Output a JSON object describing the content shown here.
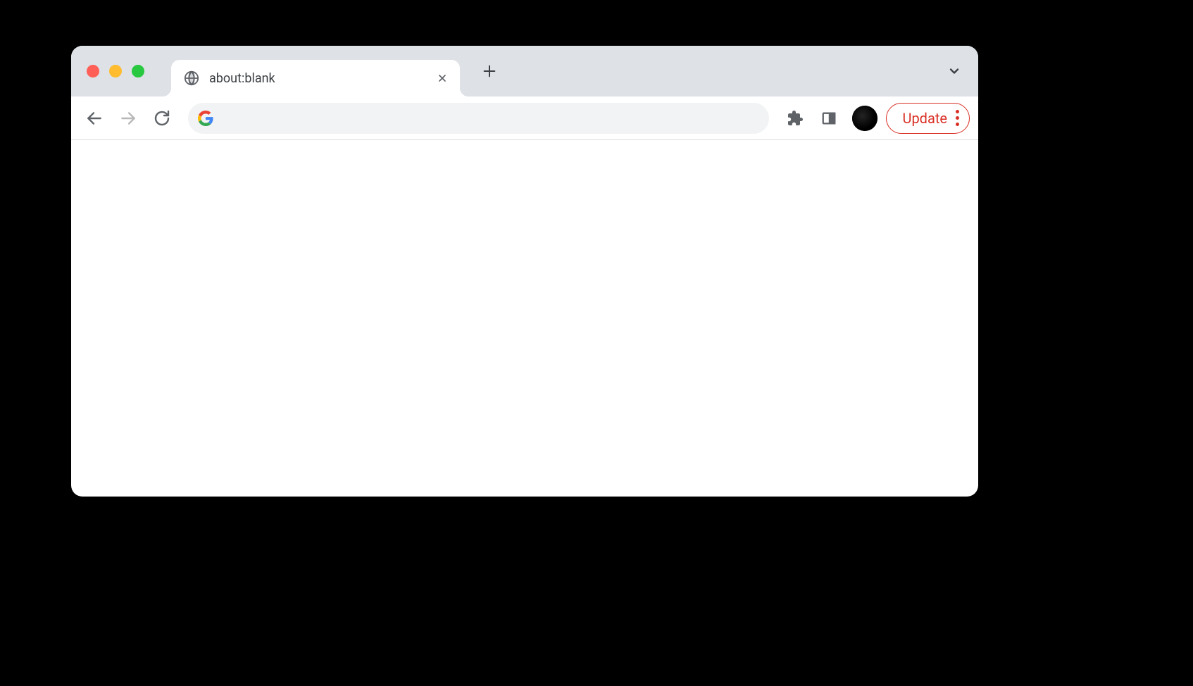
{
  "tab": {
    "title": "about:blank"
  },
  "address_bar": {
    "url": ""
  },
  "update_button": {
    "label": "Update"
  },
  "colors": {
    "accent_red": "#d93025",
    "tab_strip_bg": "#dee1e6",
    "address_bar_bg": "#f1f3f4"
  }
}
